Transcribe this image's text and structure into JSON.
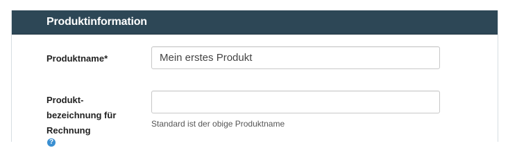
{
  "panel": {
    "title": "Produktinformation"
  },
  "fields": {
    "product_name": {
      "label": "Produktname*",
      "value": "Mein erstes Produkt",
      "placeholder": ""
    },
    "invoice_description": {
      "label_line1": "Produkt-",
      "label_line2": "bezeichnung für",
      "label_line3": "Rechnung",
      "help_icon": "?",
      "value": "",
      "placeholder": "",
      "help_text": "Standard ist der obige Produktname"
    }
  },
  "colors": {
    "header_background": "#2d4756",
    "header_text": "#ffffff",
    "help_icon": "#3a8fd1"
  },
  "icons": {
    "help": "question-circle-icon"
  }
}
